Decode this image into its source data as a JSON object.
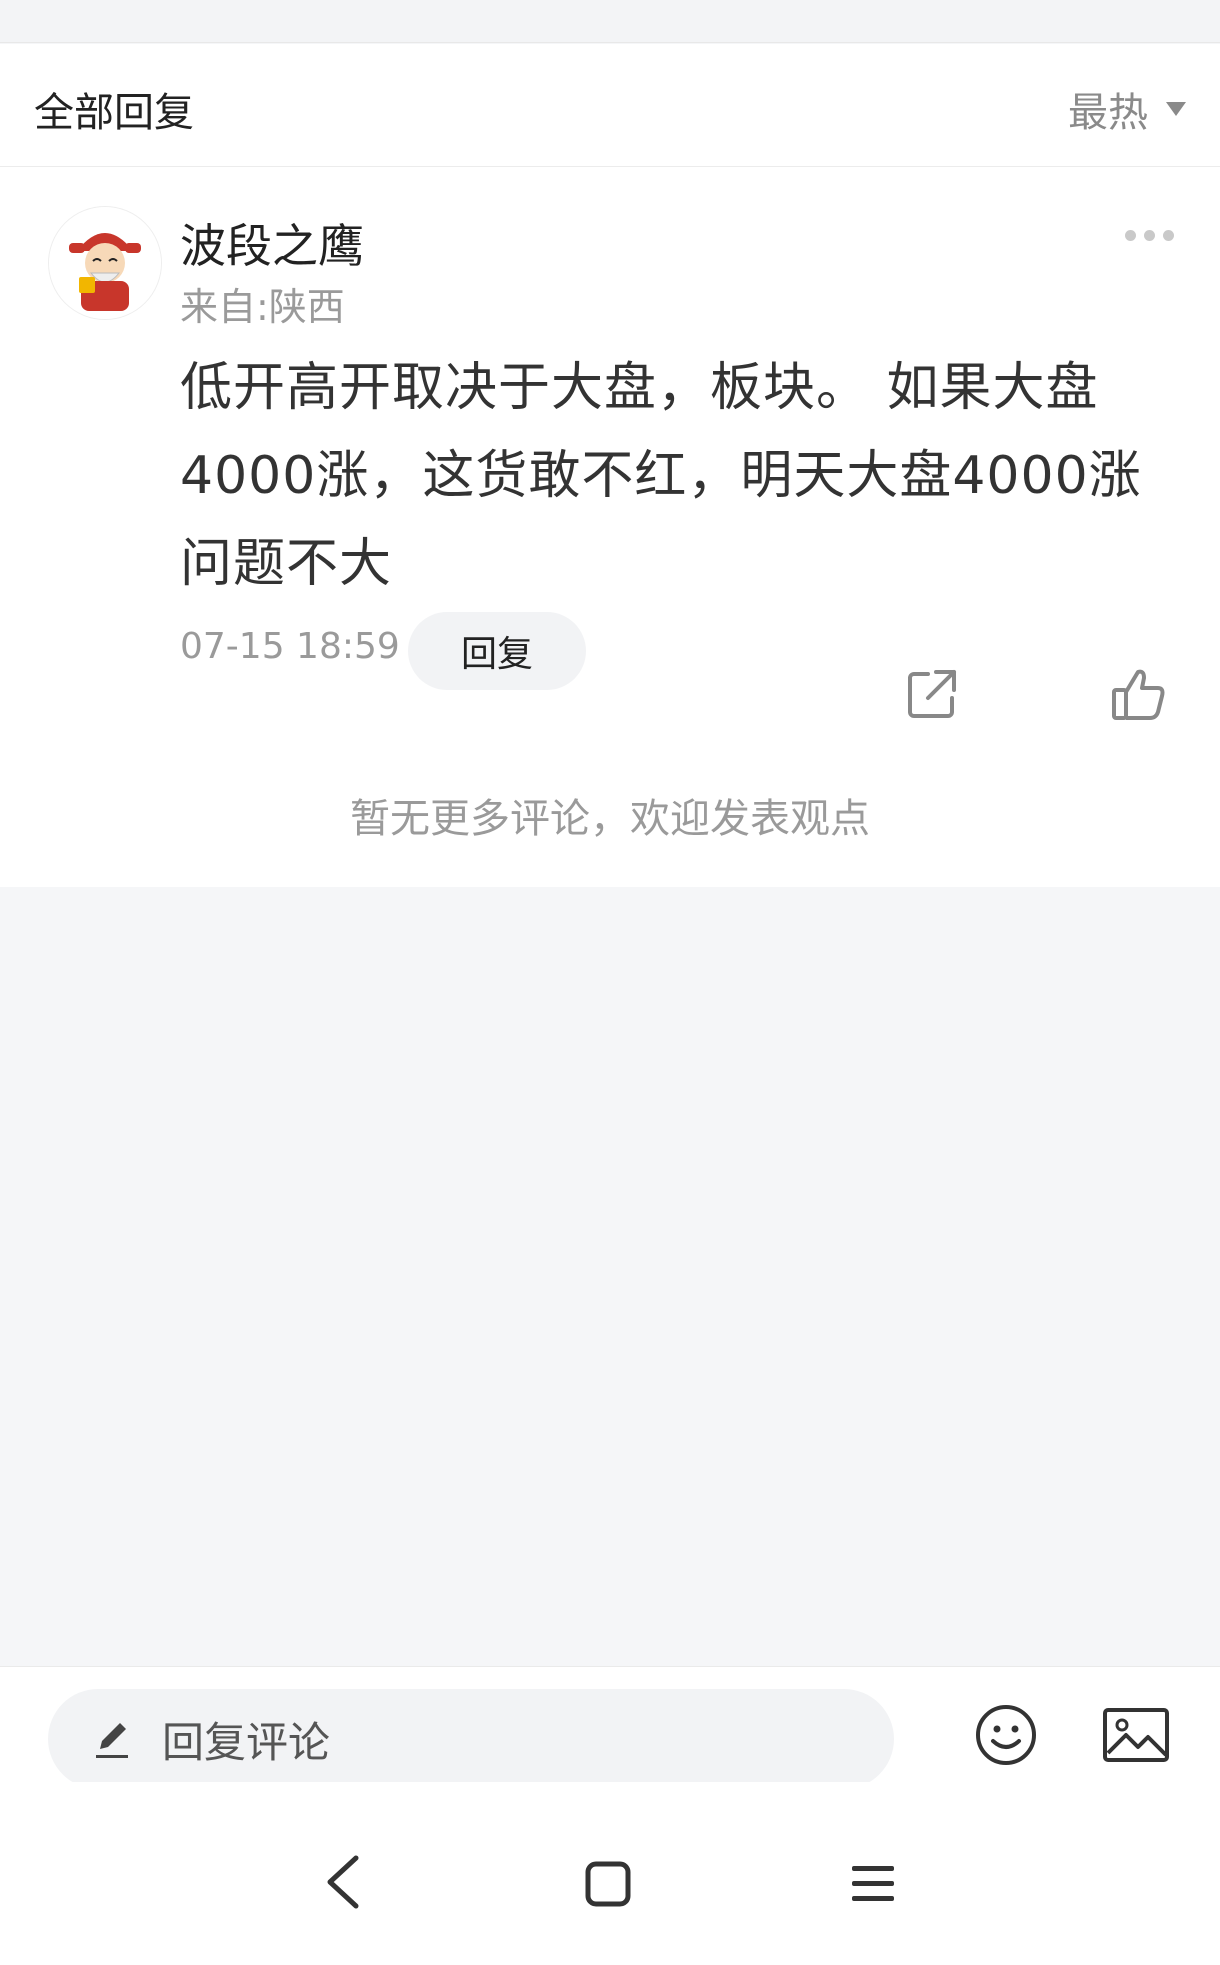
{
  "header": {
    "title": "全部回复",
    "sort_label": "最热"
  },
  "comment": {
    "username": "波段之鹰",
    "location": "来自:陕西",
    "text": "低开高开取决于大盘，板块。 如果大盘4000涨，这货敢不红，明天大盘4000涨问题不大",
    "timestamp": "07-15 18:59",
    "reply_label": "回复"
  },
  "footer_notice": "暂无更多评论，欢迎发表观点",
  "input_bar": {
    "placeholder": "回复评论"
  },
  "icons": [
    "sort-caret-icon",
    "more-icon",
    "share-icon",
    "like-icon",
    "pencil-icon",
    "emoji-icon",
    "image-icon",
    "back-icon",
    "home-icon",
    "menu-icon"
  ]
}
